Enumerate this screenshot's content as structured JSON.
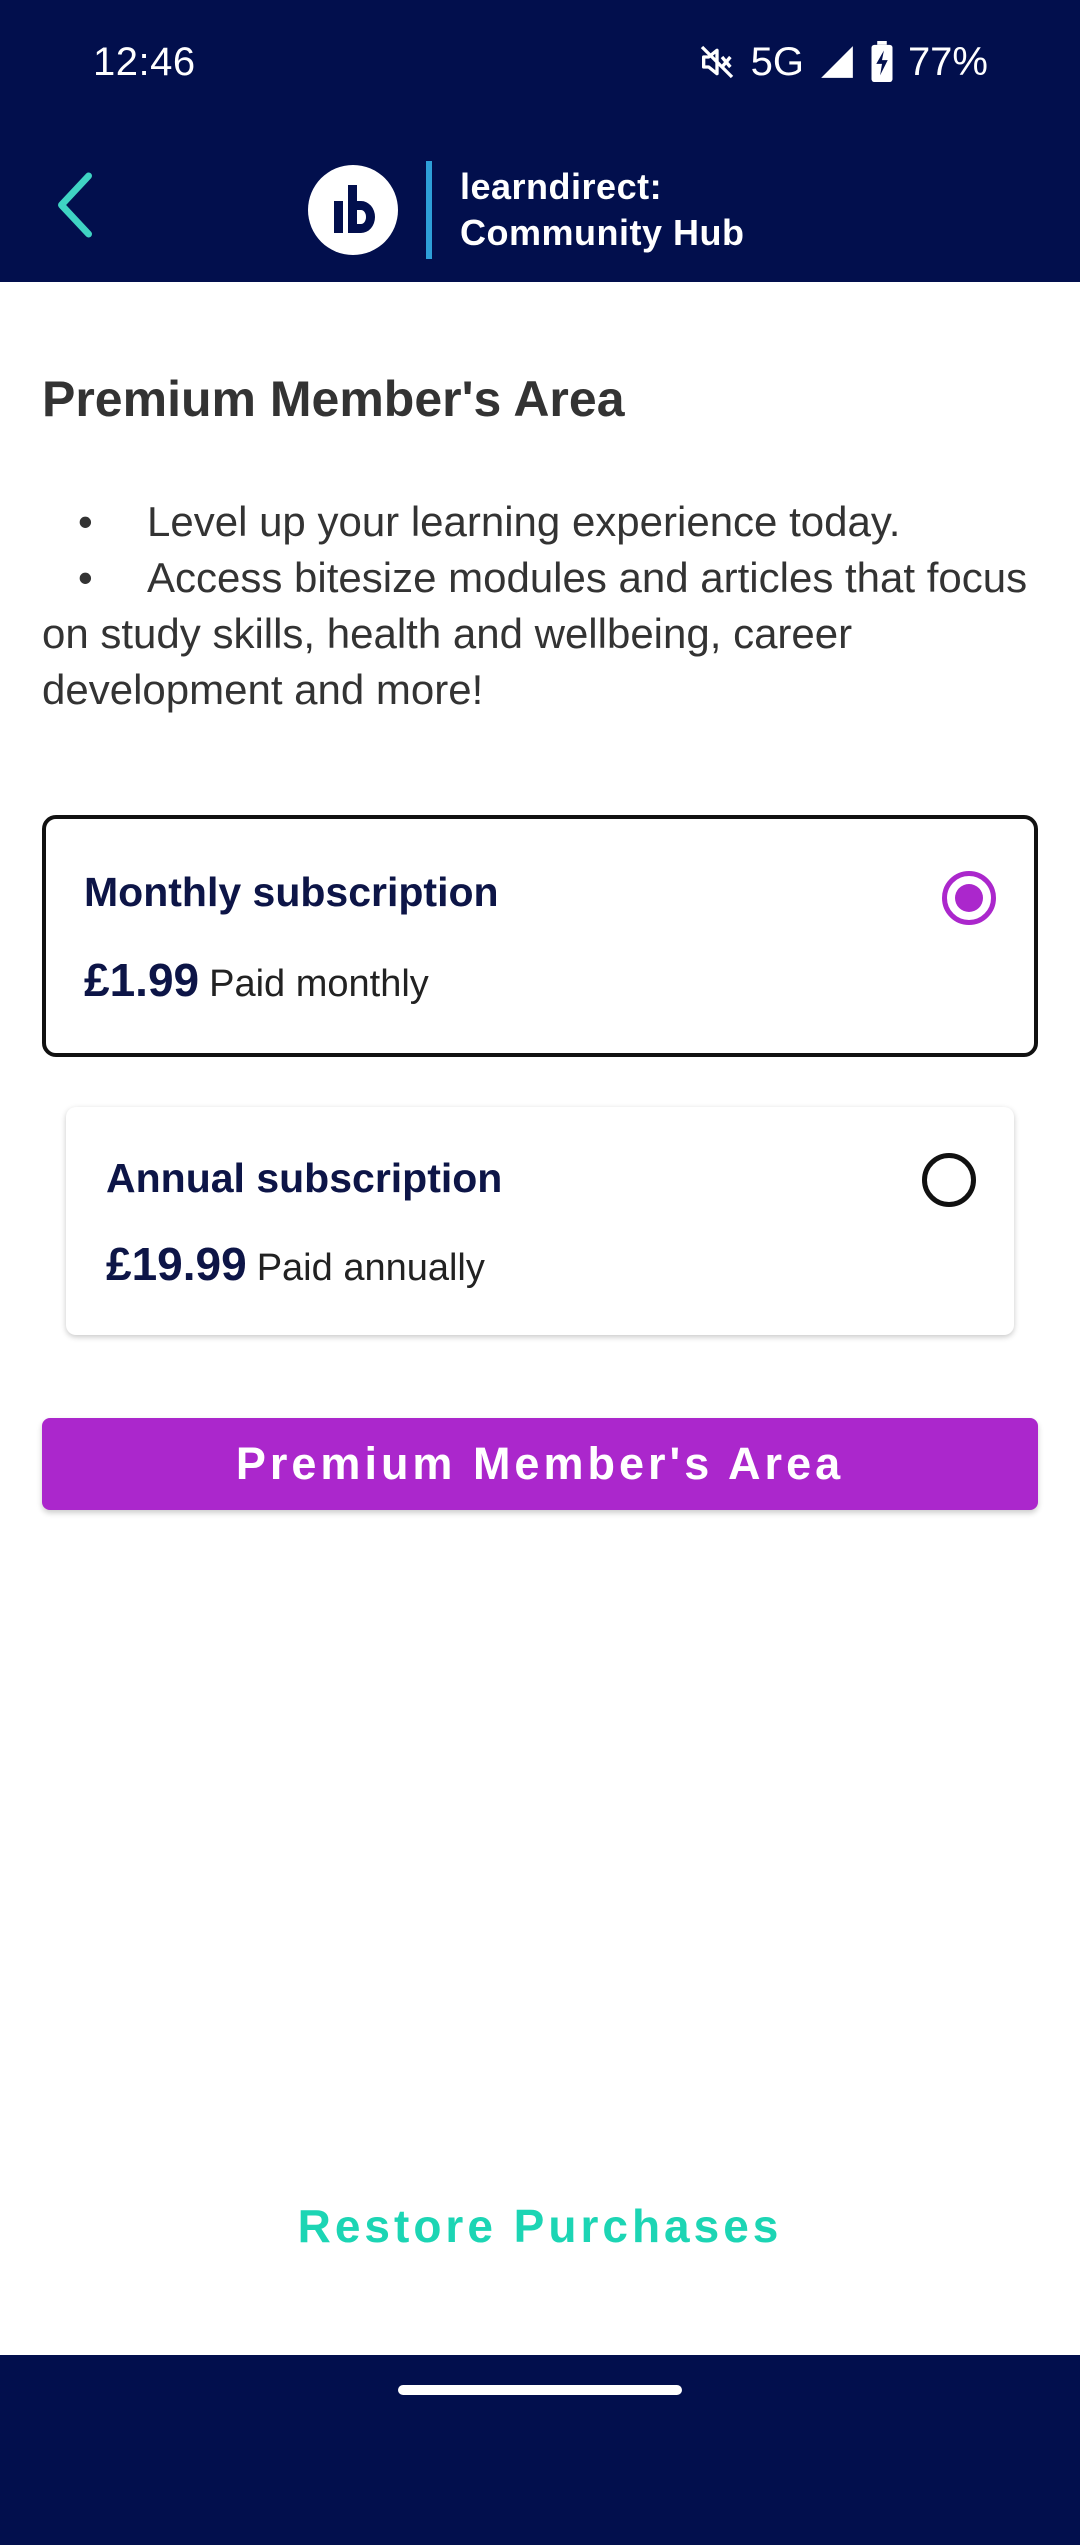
{
  "status_bar": {
    "time": "12:46",
    "network": "5G",
    "battery": "77%",
    "icons": [
      "mute-icon",
      "signal-icon",
      "battery-charging-icon"
    ]
  },
  "app_bar": {
    "title_line1": "learndirect:",
    "title_line2": "Community Hub",
    "back_icon": "chevron-left-icon",
    "logo_icon": "learndirect-logo"
  },
  "page": {
    "title": "Premium Member's Area",
    "bullets": [
      "Level up your learning experience today.",
      "Access bitesize modules and articles that focus on study skills, health and wellbeing, career development and more!"
    ]
  },
  "plans": [
    {
      "name": "Monthly subscription",
      "price": "£1.99",
      "frequency": "Paid monthly",
      "selected": true
    },
    {
      "name": "Annual subscription",
      "price": "£19.99",
      "frequency": "Paid annually",
      "selected": false
    }
  ],
  "cta_label": "Premium Member's Area",
  "restore_label": "Restore Purchases",
  "colors": {
    "header_bg": "#020f4d",
    "accent": "#ab27cc",
    "restore": "#1cd5b4",
    "back_arrow": "#3fd3c3",
    "divider": "#2e9fd8"
  }
}
